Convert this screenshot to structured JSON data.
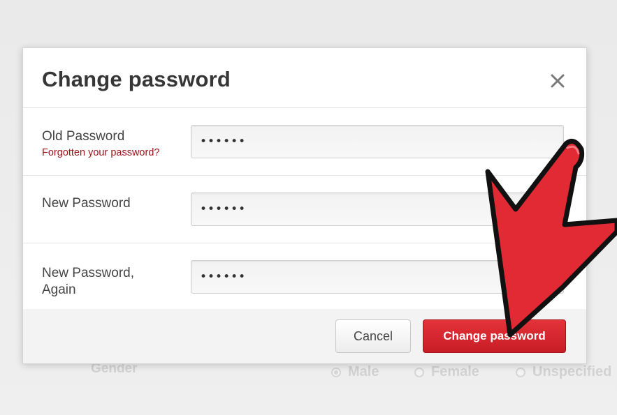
{
  "dialog": {
    "title": "Change password",
    "close_icon": "close-icon"
  },
  "fields": [
    {
      "label": "Old Password",
      "value": "••••••",
      "link": "Forgotten your password?"
    },
    {
      "label": "New Password",
      "value": "••••••"
    },
    {
      "label": "New Password, Again",
      "value": "••••••"
    }
  ],
  "buttons": {
    "cancel": "Cancel",
    "submit": "Change password"
  },
  "background": {
    "gender_label": "Gender",
    "options": [
      "Male",
      "Female",
      "Unspecified"
    ]
  },
  "annotation": {
    "icon": "red-pointer-arrow-icon",
    "color": "#e12a33"
  },
  "colors": {
    "primary_button": "#d4262e",
    "link": "#a0141c"
  }
}
